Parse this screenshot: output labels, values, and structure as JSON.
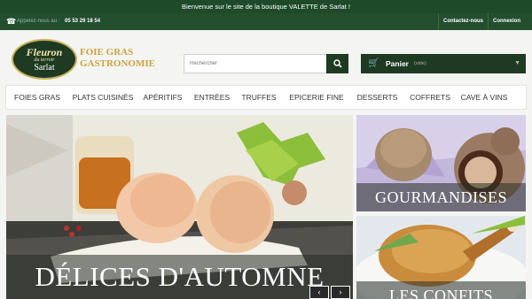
{
  "banner": {
    "text": "Bienvenue sur le site de la boutique VALETTE de Sarlat !"
  },
  "contact": {
    "call_label": "Appelez-nous au :",
    "phone": "05 53 29 18 54",
    "links": [
      "Contactez-nous",
      "Connexion"
    ]
  },
  "logo": {
    "line1": "Fleuron",
    "line2": "du terroir",
    "line3": "Sarlat"
  },
  "tagline": {
    "line1": "FOIE GRAS",
    "line2": "GASTRONOMIE"
  },
  "search": {
    "placeholder": "Rechercher"
  },
  "cart": {
    "label": "Panier",
    "status": "(vide)"
  },
  "nav": {
    "items": [
      "FOIES GRAS",
      "PLATS CUISINÉS",
      "APÉRITIFS",
      "ENTRÉES",
      "TRUFFES",
      "EPICERIE FINE",
      "DESSERTS",
      "COFFRETS",
      "CAVE À VINS"
    ]
  },
  "slider": {
    "main_caption": "DÉLICES D'AUTOMNE",
    "prev": "‹",
    "next": "›"
  },
  "promos": [
    {
      "caption": "GOURMANDISES"
    },
    {
      "caption": "LES CONFITS"
    }
  ],
  "icons": {
    "phone": "phone-icon",
    "search": "search-icon",
    "cart": "cart-icon"
  },
  "colors": {
    "dark_green": "#1f3a22",
    "gold": "#c8a440"
  }
}
